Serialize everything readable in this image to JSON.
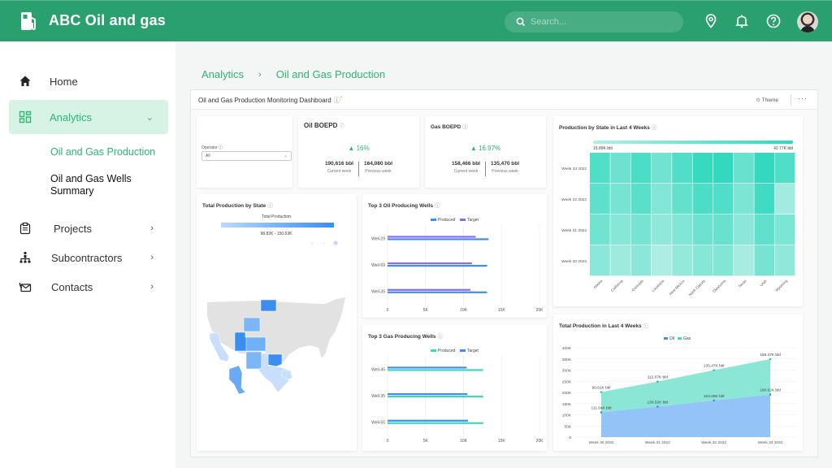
{
  "header": {
    "title": "ABC Oil and gas",
    "search_placeholder": "Search...",
    "icons": [
      "fuel-pump-icon",
      "search-icon",
      "location-icon",
      "bell-icon",
      "help-icon",
      "avatar"
    ]
  },
  "sidebar": {
    "items": [
      {
        "label": "Home",
        "icon": "home-icon"
      },
      {
        "label": "Analytics",
        "icon": "dashboard-icon",
        "active": true,
        "chevron": "⌄"
      },
      {
        "label": "Projects",
        "icon": "clipboard-icon",
        "chevron": "›"
      },
      {
        "label": "Subcontractors",
        "icon": "org-chart-icon",
        "chevron": "›"
      },
      {
        "label": "Contacts",
        "icon": "contacts-icon",
        "chevron": "›"
      }
    ],
    "sub_items": [
      {
        "label": "Oil and Gas Production",
        "active": true
      },
      {
        "label": "Oil and Gas Wells Summary",
        "line1": "Oil and Gas Wells",
        "line2": "Summary"
      }
    ]
  },
  "breadcrumb": {
    "items": [
      "Analytics",
      "Oil and Gas Production"
    ],
    "separator": "›"
  },
  "dashboard": {
    "title": "Oil and Gas Production Monitoring Dashboard",
    "info": "ⓘ",
    "modified_marker": "*",
    "theme_label": "Theme",
    "more_label": "···",
    "operator": {
      "label": "Operator",
      "info": "ⓘ",
      "value": "All"
    },
    "oil_kpi": {
      "title": "Oil BOEPD",
      "info": "ⓘ",
      "change": "▲ 16%",
      "current_value": "190,616 bbl",
      "current_label": "Current week",
      "previous_value": "164,080 bbl",
      "previous_label": "Previous week"
    },
    "gas_kpi": {
      "title": "Gas BOEPD",
      "info": "ⓘ",
      "change": "▲ 16.97%",
      "current_value": "158,466 bbl",
      "current_label": "Current week",
      "previous_value": "135,470 bbl",
      "previous_label": "Previous week"
    },
    "colors": {
      "accent": "#2bb673",
      "header": "#2ba06f",
      "oil": "#3d8ef0",
      "gas": "#3ed6c0",
      "target_purple": "#8a6cf0"
    }
  },
  "chart_data": [
    {
      "type": "heatmap",
      "title": "Production by State in Last 4 Weeks",
      "legend_min": "15.89K bbl",
      "legend_max": "42.77K bbl",
      "x": [
        "Alaska",
        "California",
        "Colorado",
        "Louisiana",
        "New Mexico",
        "North Dakota",
        "Oklahoma",
        "Texas",
        "Utah",
        "Wyoming"
      ],
      "y": [
        "Week 33 2022",
        "Week 32 2022",
        "Week 31 2022",
        "Week 30 2022"
      ],
      "values": [
        [
          36,
          30,
          37,
          29,
          36,
          41,
          42,
          31,
          42,
          36
        ],
        [
          33,
          28,
          34,
          26,
          32,
          37,
          36,
          27,
          39,
          19
        ],
        [
          29,
          25,
          28,
          23,
          26,
          30,
          31,
          24,
          33,
          27
        ],
        [
          24,
          20,
          24,
          17,
          22,
          25,
          26,
          18,
          28,
          23
        ]
      ],
      "value_range": [
        15.89,
        42.77
      ]
    },
    {
      "type": "map",
      "title": "Total Production by State",
      "legend_title": "Total Production",
      "legend_range": "98.82K - 150.63K",
      "highlighted_states": [
        "North Dakota",
        "Wyoming",
        "Utah",
        "Colorado",
        "New Mexico",
        "Oklahoma",
        "Texas",
        "California",
        "Louisiana",
        "Alaska"
      ]
    },
    {
      "type": "bar",
      "orientation": "horizontal",
      "title": "Top 3 Oil Producing Wells",
      "categories": [
        "Well-29",
        "Well-59",
        "Well-35"
      ],
      "series": [
        {
          "name": "Produced",
          "values": [
            13300,
            13100,
            13100
          ]
        },
        {
          "name": "Target",
          "values": [
            11600,
            11100,
            10900
          ]
        }
      ],
      "xticks": [
        "0",
        "5K",
        "10K",
        "15K",
        "20K"
      ],
      "xlim": [
        0,
        20000
      ],
      "legend": "top"
    },
    {
      "type": "bar",
      "orientation": "horizontal",
      "title": "Top 3 Gas Producing Wells",
      "categories": [
        "Well-45",
        "Well-35",
        "Well-55"
      ],
      "series": [
        {
          "name": "Produced",
          "values": [
            12600,
            12600,
            12600
          ]
        },
        {
          "name": "Target",
          "values": [
            10400,
            10500,
            10600
          ]
        }
      ],
      "xticks": [
        "0",
        "5K",
        "10K",
        "15K",
        "20K"
      ],
      "xlim": [
        0,
        20000
      ],
      "legend": "top"
    },
    {
      "type": "area",
      "stacked": true,
      "title": "Total Production in Last 4 Weeks",
      "categories": [
        "Week 30 2022",
        "Week 31 2022",
        "Week 32 2022",
        "Week 33 2022"
      ],
      "series": [
        {
          "name": "Oil",
          "values": [
            111.04,
            136.52,
            164.08,
            190.62
          ],
          "labels": [
            "111.04K bbl",
            "136.52K bbl",
            "164.08K bbl",
            "190.62K bbl"
          ]
        },
        {
          "name": "Gas",
          "values": [
            90.61,
            112.07,
            135.47,
            158.47
          ],
          "labels": [
            "90.61K bbl",
            "112.07K bbl",
            "135.47K bbl",
            "158.47K bbl"
          ]
        }
      ],
      "yticks": [
        "0",
        "50K",
        "100K",
        "150K",
        "200K",
        "250K",
        "300K",
        "350K",
        "400K"
      ],
      "ylim": [
        0,
        400
      ],
      "legend": "top"
    }
  ]
}
